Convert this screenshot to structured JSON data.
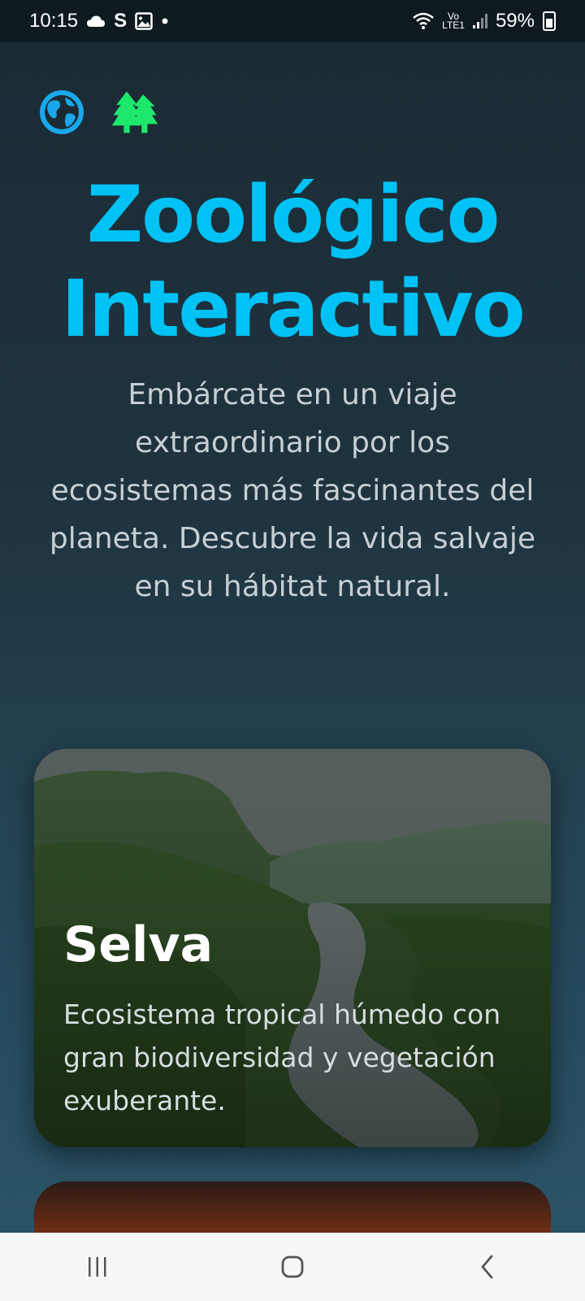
{
  "status_bar": {
    "time": "10:15",
    "notif_s": "S",
    "battery": "59%",
    "volte": "Vo",
    "lte": "LTE1"
  },
  "header_icons": [
    "globe-icon",
    "trees-icon"
  ],
  "hero": {
    "title_line1": "Zoológico",
    "title_line2": "Interactivo",
    "description": "Embárcate en un viaje extraordinario por los ecosistemas más fascinantes del planeta. Descubre la vida salvaje en su hábitat natural."
  },
  "cards": [
    {
      "title": "Selva",
      "description": "Ecosistema tropical húmedo con gran biodiversidad y vegetación exuberante."
    }
  ],
  "colors": {
    "accent": "#00c2f5",
    "tree_icon": "#1ee86b",
    "globe_icon": "#1aa8ec"
  },
  "nav_bar": [
    "recents-icon",
    "home-icon",
    "back-icon"
  ]
}
